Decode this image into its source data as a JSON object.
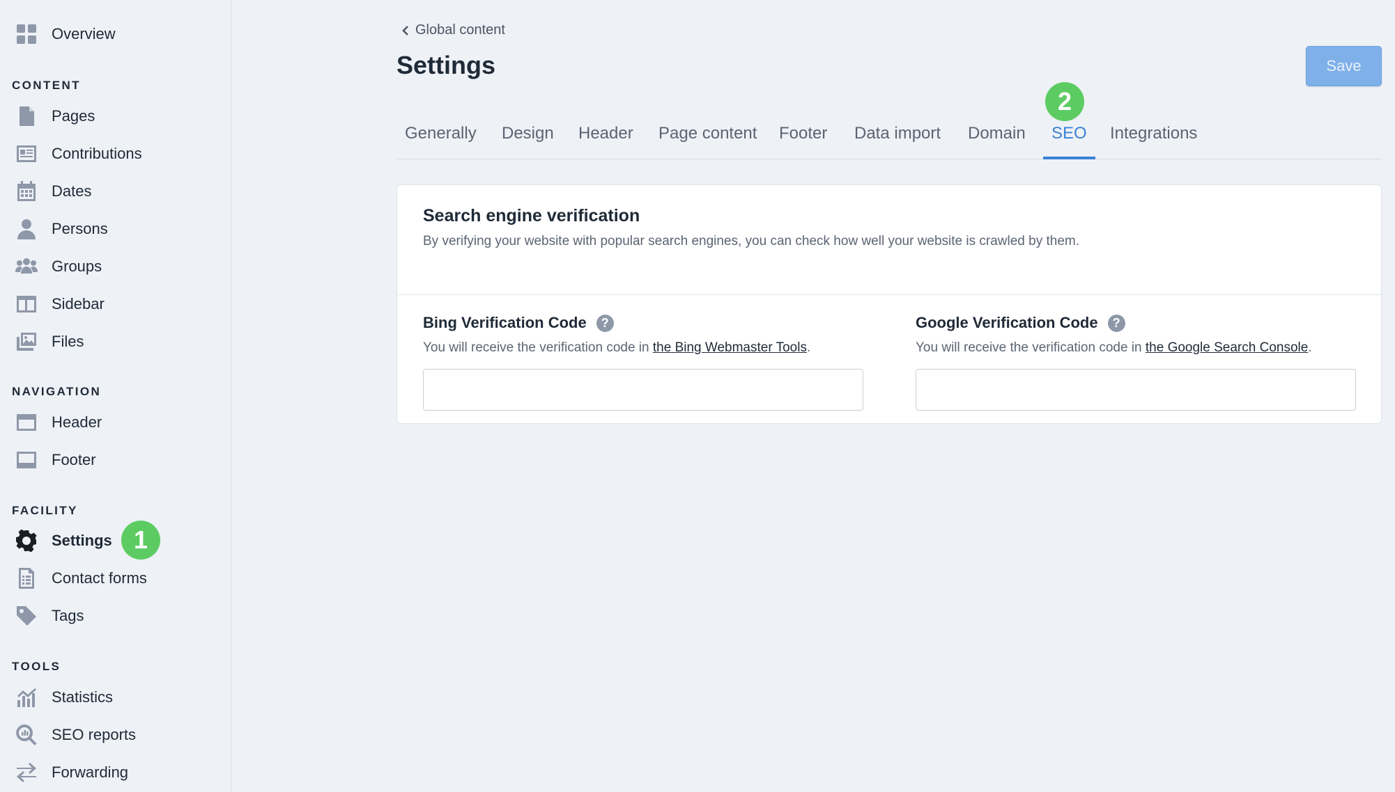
{
  "sidebar": {
    "overview": "Overview",
    "sections": {
      "content": "CONTENT",
      "navigation": "NAVIGATION",
      "facility": "FACILITY",
      "tools": "TOOLS"
    },
    "items": {
      "pages": "Pages",
      "contributions": "Contributions",
      "dates": "Dates",
      "persons": "Persons",
      "groups": "Groups",
      "sidebar": "Sidebar",
      "files": "Files",
      "header": "Header",
      "footer": "Footer",
      "settings": "Settings",
      "contact_forms": "Contact forms",
      "tags": "Tags",
      "statistics": "Statistics",
      "seo_reports": "SEO reports",
      "forwarding": "Forwarding"
    },
    "active_item": "Settings"
  },
  "badges": {
    "one": "1",
    "two": "2"
  },
  "colors": {
    "badge": "#5ccc62",
    "accent": "#3b82d6",
    "save_button": "#7fb0e9"
  },
  "header": {
    "breadcrumb": "Global content",
    "title": "Settings",
    "save_label": "Save"
  },
  "tabs": [
    {
      "label": "Generally"
    },
    {
      "label": "Design"
    },
    {
      "label": "Header"
    },
    {
      "label": "Page content"
    },
    {
      "label": "Footer"
    },
    {
      "label": "Data import"
    },
    {
      "label": "Domain"
    },
    {
      "label": "SEO",
      "active": true
    },
    {
      "label": "Integrations"
    }
  ],
  "card": {
    "title": "Search engine verification",
    "description": "By verifying your website with popular search engines, you can check how well your website is crawled by them.",
    "bing": {
      "label": "Bing Verification Code",
      "hint_prefix": "You will receive the verification code in ",
      "hint_link": "the Bing Webmaster Tools",
      "hint_suffix": ".",
      "value": ""
    },
    "google": {
      "label": "Google Verification Code",
      "hint_prefix": "You will receive the verification code in ",
      "hint_link": "the Google Search Console",
      "hint_suffix": ".",
      "value": ""
    }
  }
}
